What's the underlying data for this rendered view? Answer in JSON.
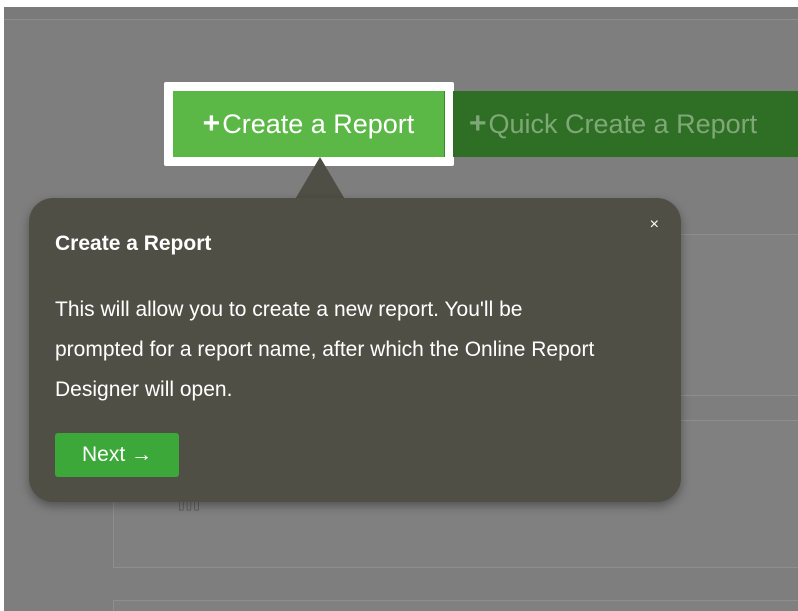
{
  "toolbar": {
    "create_report_label": "Create a Report",
    "quick_create_label": "Quick Create a Report",
    "plus_glyph": "+"
  },
  "tooltip": {
    "title": "Create a Report",
    "body": "This will allow you to create a new report. You'll be prompted for a report name, after which the Online Report Designer will open.",
    "close_glyph": "×",
    "next_label": "Next →"
  },
  "background": {
    "dots": "▯▯▯"
  },
  "colors": {
    "create_button": "#5bb846",
    "quick_button": "#2f6e25",
    "tooltip_bg": "#4f4f45",
    "next_button": "#3ca83a",
    "overlay": "#7e7e7e"
  }
}
